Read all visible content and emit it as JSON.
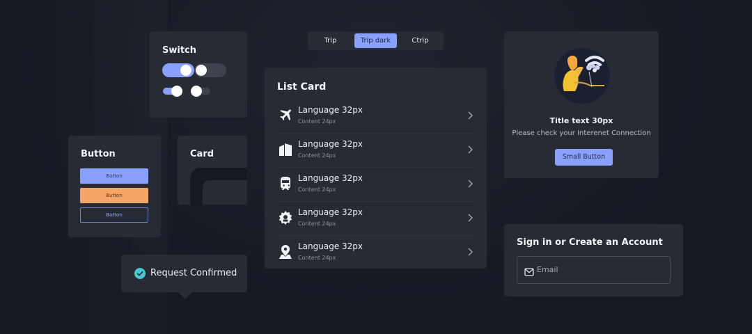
{
  "switch_card": {
    "title": "Switch",
    "toggles": [
      {
        "state": "on",
        "size": "large"
      },
      {
        "state": "off",
        "size": "large"
      },
      {
        "state": "on",
        "size": "small"
      },
      {
        "state": "off",
        "size": "small"
      }
    ]
  },
  "button_card": {
    "title": "Button",
    "buttons": [
      {
        "label": "Button",
        "style": "primary"
      },
      {
        "label": "Button",
        "style": "orange"
      },
      {
        "label": "Button",
        "style": "outline"
      }
    ]
  },
  "card_card": {
    "title": "Card"
  },
  "toast": {
    "label": "Request Confirmed",
    "icon": "check-circle-icon"
  },
  "tabs": [
    {
      "label": "Trip",
      "active": false
    },
    {
      "label": "Trip dark",
      "active": true
    },
    {
      "label": "Ctrip",
      "active": false
    }
  ],
  "list_card": {
    "title": "List Card",
    "items": [
      {
        "icon": "airplane-icon",
        "title": "Language 32px",
        "subtitle": "Content 24px"
      },
      {
        "icon": "building-icon",
        "title": "Language 32px",
        "subtitle": "Content 24px"
      },
      {
        "icon": "train-icon",
        "title": "Language 32px",
        "subtitle": "Content 24px"
      },
      {
        "icon": "attraction-icon",
        "title": "Language 32px",
        "subtitle": "Content 24px"
      },
      {
        "icon": "map-pin-icon",
        "title": "Language 32px",
        "subtitle": "Content 24px"
      }
    ]
  },
  "empty_state": {
    "title": "Title text 30px",
    "text": "Please check your Interenet Connection",
    "button_label": "Small Button"
  },
  "signin": {
    "title": "Sign in or Create an Account",
    "email_placeholder": "Email"
  },
  "colors": {
    "background": "#151922",
    "panel": "#272b33",
    "accent": "#8aa0ff",
    "orange": "#f5a568",
    "toast_check": "#47c8d4"
  }
}
